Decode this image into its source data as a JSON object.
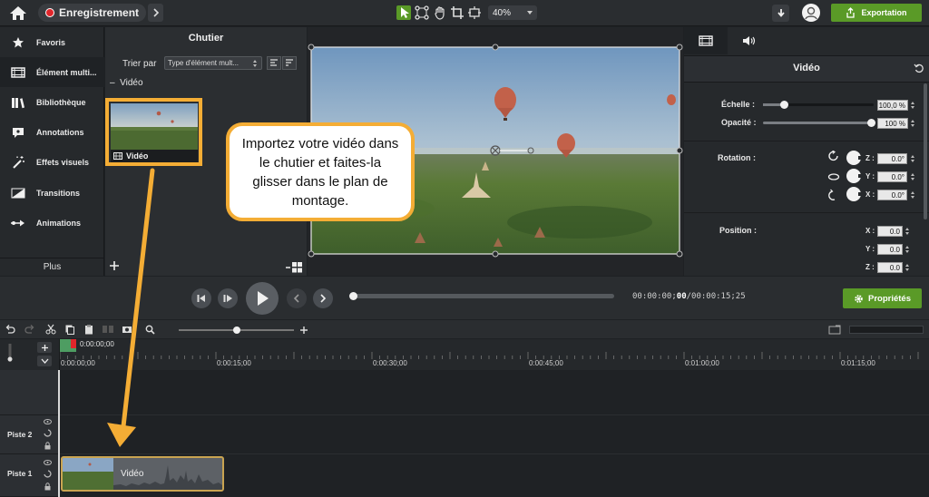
{
  "topbar": {
    "record_label": "Enregistrement",
    "zoom": "40%",
    "export_label": "Exportation"
  },
  "sidebar": {
    "items": [
      {
        "label": "Favoris",
        "icon": "star-icon"
      },
      {
        "label": "Élément multi...",
        "icon": "film-icon"
      },
      {
        "label": "Bibliothèque",
        "icon": "library-icon"
      },
      {
        "label": "Annotations",
        "icon": "annotation-icon"
      },
      {
        "label": "Effets visuels",
        "icon": "magic-wand-icon"
      },
      {
        "label": "Transitions",
        "icon": "transition-icon"
      },
      {
        "label": "Animations",
        "icon": "animation-icon"
      }
    ],
    "more_label": "Plus"
  },
  "bin": {
    "title": "Chutier",
    "sort_label": "Trier par",
    "sort_value": "Type d'élément mult...",
    "section_label": "Vidéo",
    "media_name": "Vidéo"
  },
  "callout": {
    "text": "Importez votre vidéo dans le chutier et faites-la glisser dans le plan de montage."
  },
  "properties": {
    "title": "Vidéo",
    "scale_label": "Échelle :",
    "scale_value": "100,0 %",
    "scale_fraction": 1.0,
    "opacity_label": "Opacité :",
    "opacity_value": "100 %",
    "opacity_fraction": 1.0,
    "rotation_label": "Rotation :",
    "rotation": {
      "z": "0.0°",
      "y": "0.0°",
      "x": "0.0°"
    },
    "position_label": "Position :",
    "position": {
      "x": "0.0",
      "y": "0.0",
      "z": "0.0"
    },
    "axis": {
      "z": "Z :",
      "y": "Y :",
      "x": "X :"
    }
  },
  "transport": {
    "timecode_current": "00:00:00;",
    "timecode_frame": "00",
    "timecode_total": "/00:00:15;25",
    "properties_button": "Propriétés"
  },
  "timeline": {
    "playhead_time": "0:00:00;00",
    "ticks": [
      "0:00:00;00",
      "0:00:15;00",
      "0:00:30;00",
      "0:00:45;00",
      "0:01:00;00",
      "0:01:15;00"
    ],
    "tracks": [
      {
        "name": "Piste 2"
      },
      {
        "name": "Piste 1"
      }
    ],
    "clip_label": "Vidéo"
  },
  "colors": {
    "accent_green": "#5a9a27",
    "callout_orange": "#f4ad35",
    "record_red": "#e0262b"
  }
}
